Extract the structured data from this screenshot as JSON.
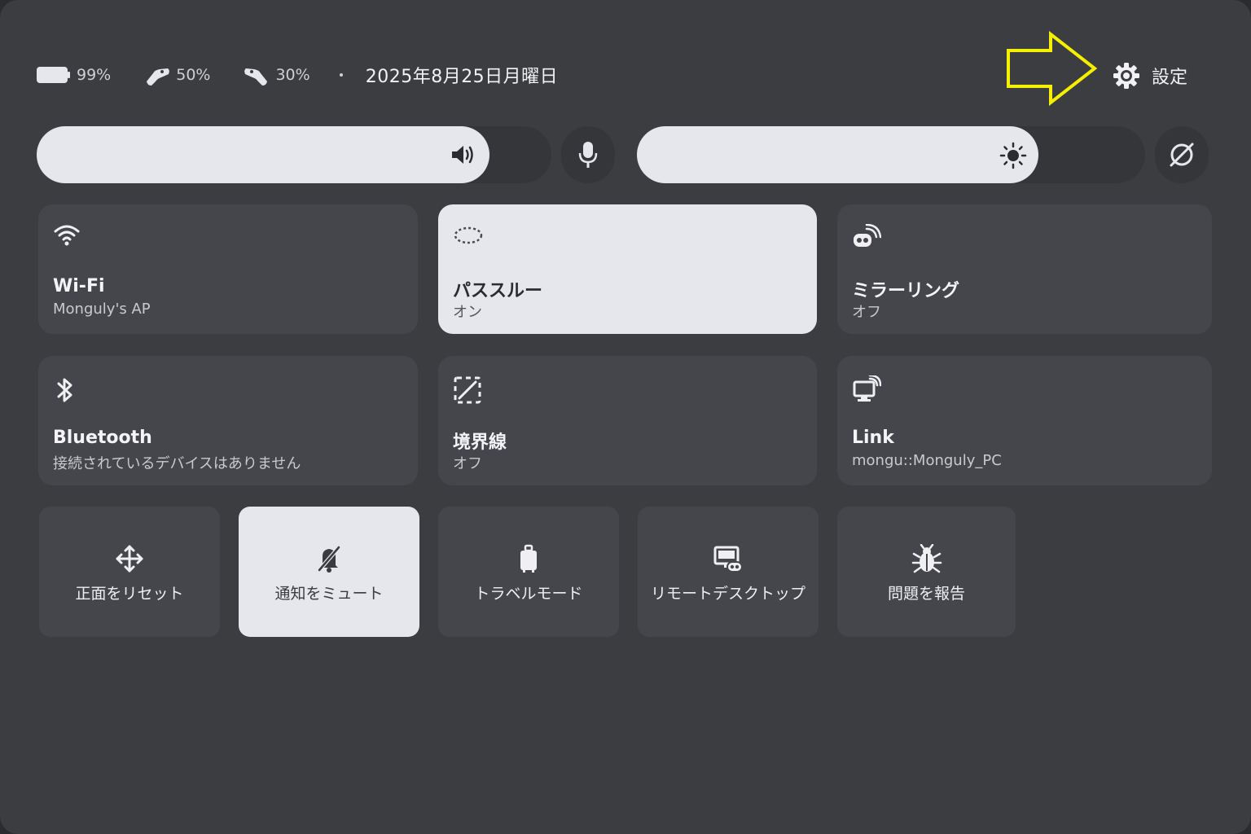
{
  "status": {
    "battery_headset": "99%",
    "battery_controller_left": "50%",
    "battery_controller_right": "30%",
    "date": "2025年8月25日月曜日"
  },
  "settings": {
    "label": "設定"
  },
  "sliders": {
    "volume": {
      "level_percent": 88
    },
    "brightness": {
      "level_percent": 79
    }
  },
  "tiles": [
    {
      "title": "Wi-Fi",
      "subtitle": "Monguly's AP",
      "active": false,
      "icon": "wifi-icon"
    },
    {
      "title": "パススルー",
      "subtitle": "オン",
      "active": true,
      "icon": "passthrough-icon"
    },
    {
      "title": "ミラーリング",
      "subtitle": "オフ",
      "active": false,
      "icon": "cast-icon"
    },
    {
      "title": "Bluetooth",
      "subtitle": "接続されているデバイスはありません",
      "active": false,
      "icon": "bluetooth-icon"
    },
    {
      "title": "境界線",
      "subtitle": "オフ",
      "active": false,
      "icon": "boundary-icon"
    },
    {
      "title": "Link",
      "subtitle": "mongu::Monguly_PC",
      "active": false,
      "icon": "link-icon"
    }
  ],
  "actions": [
    {
      "label": "正面をリセット",
      "active": false,
      "icon": "move-icon"
    },
    {
      "label": "通知をミュート",
      "active": true,
      "icon": "bell-off-icon"
    },
    {
      "label": "トラベルモード",
      "active": false,
      "icon": "luggage-icon"
    },
    {
      "label": "リモートデスクトップ",
      "active": false,
      "icon": "remote-desktop-icon"
    },
    {
      "label": "問題を報告",
      "active": false,
      "icon": "bug-icon"
    }
  ],
  "colors": {
    "panel": "#3c3d41",
    "tile": "#45464b",
    "tile_active": "#e6e7ec",
    "annotation_arrow": "#f5f000"
  }
}
